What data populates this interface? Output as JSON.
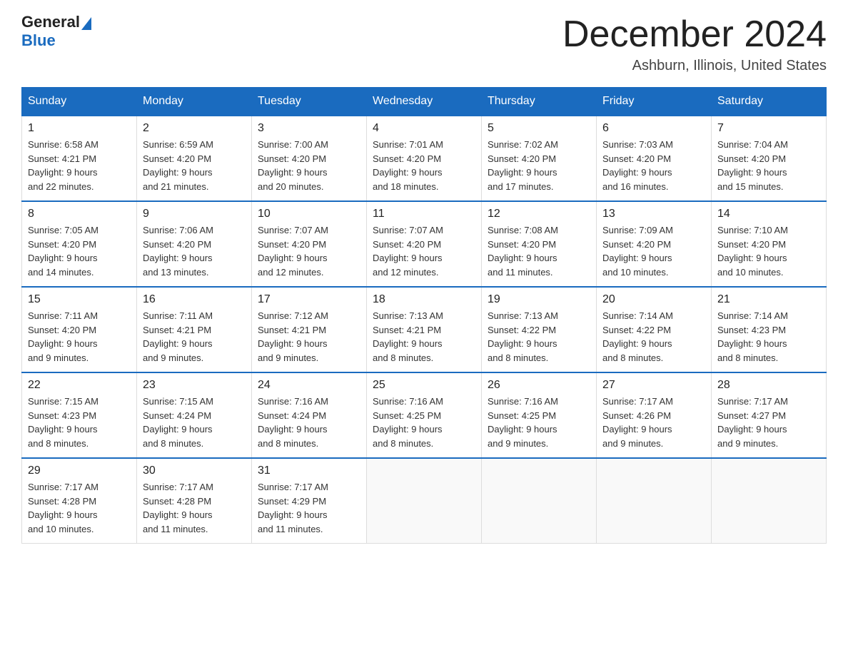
{
  "header": {
    "logo_general": "General",
    "logo_blue": "Blue",
    "month_title": "December 2024",
    "location": "Ashburn, Illinois, United States"
  },
  "weekdays": [
    "Sunday",
    "Monday",
    "Tuesday",
    "Wednesday",
    "Thursday",
    "Friday",
    "Saturday"
  ],
  "weeks": [
    [
      {
        "day": "1",
        "sunrise": "6:58 AM",
        "sunset": "4:21 PM",
        "daylight": "9 hours and 22 minutes."
      },
      {
        "day": "2",
        "sunrise": "6:59 AM",
        "sunset": "4:20 PM",
        "daylight": "9 hours and 21 minutes."
      },
      {
        "day": "3",
        "sunrise": "7:00 AM",
        "sunset": "4:20 PM",
        "daylight": "9 hours and 20 minutes."
      },
      {
        "day": "4",
        "sunrise": "7:01 AM",
        "sunset": "4:20 PM",
        "daylight": "9 hours and 18 minutes."
      },
      {
        "day": "5",
        "sunrise": "7:02 AM",
        "sunset": "4:20 PM",
        "daylight": "9 hours and 17 minutes."
      },
      {
        "day": "6",
        "sunrise": "7:03 AM",
        "sunset": "4:20 PM",
        "daylight": "9 hours and 16 minutes."
      },
      {
        "day": "7",
        "sunrise": "7:04 AM",
        "sunset": "4:20 PM",
        "daylight": "9 hours and 15 minutes."
      }
    ],
    [
      {
        "day": "8",
        "sunrise": "7:05 AM",
        "sunset": "4:20 PM",
        "daylight": "9 hours and 14 minutes."
      },
      {
        "day": "9",
        "sunrise": "7:06 AM",
        "sunset": "4:20 PM",
        "daylight": "9 hours and 13 minutes."
      },
      {
        "day": "10",
        "sunrise": "7:07 AM",
        "sunset": "4:20 PM",
        "daylight": "9 hours and 12 minutes."
      },
      {
        "day": "11",
        "sunrise": "7:07 AM",
        "sunset": "4:20 PM",
        "daylight": "9 hours and 12 minutes."
      },
      {
        "day": "12",
        "sunrise": "7:08 AM",
        "sunset": "4:20 PM",
        "daylight": "9 hours and 11 minutes."
      },
      {
        "day": "13",
        "sunrise": "7:09 AM",
        "sunset": "4:20 PM",
        "daylight": "9 hours and 10 minutes."
      },
      {
        "day": "14",
        "sunrise": "7:10 AM",
        "sunset": "4:20 PM",
        "daylight": "9 hours and 10 minutes."
      }
    ],
    [
      {
        "day": "15",
        "sunrise": "7:11 AM",
        "sunset": "4:20 PM",
        "daylight": "9 hours and 9 minutes."
      },
      {
        "day": "16",
        "sunrise": "7:11 AM",
        "sunset": "4:21 PM",
        "daylight": "9 hours and 9 minutes."
      },
      {
        "day": "17",
        "sunrise": "7:12 AM",
        "sunset": "4:21 PM",
        "daylight": "9 hours and 9 minutes."
      },
      {
        "day": "18",
        "sunrise": "7:13 AM",
        "sunset": "4:21 PM",
        "daylight": "9 hours and 8 minutes."
      },
      {
        "day": "19",
        "sunrise": "7:13 AM",
        "sunset": "4:22 PM",
        "daylight": "9 hours and 8 minutes."
      },
      {
        "day": "20",
        "sunrise": "7:14 AM",
        "sunset": "4:22 PM",
        "daylight": "9 hours and 8 minutes."
      },
      {
        "day": "21",
        "sunrise": "7:14 AM",
        "sunset": "4:23 PM",
        "daylight": "9 hours and 8 minutes."
      }
    ],
    [
      {
        "day": "22",
        "sunrise": "7:15 AM",
        "sunset": "4:23 PM",
        "daylight": "9 hours and 8 minutes."
      },
      {
        "day": "23",
        "sunrise": "7:15 AM",
        "sunset": "4:24 PM",
        "daylight": "9 hours and 8 minutes."
      },
      {
        "day": "24",
        "sunrise": "7:16 AM",
        "sunset": "4:24 PM",
        "daylight": "9 hours and 8 minutes."
      },
      {
        "day": "25",
        "sunrise": "7:16 AM",
        "sunset": "4:25 PM",
        "daylight": "9 hours and 8 minutes."
      },
      {
        "day": "26",
        "sunrise": "7:16 AM",
        "sunset": "4:25 PM",
        "daylight": "9 hours and 9 minutes."
      },
      {
        "day": "27",
        "sunrise": "7:17 AM",
        "sunset": "4:26 PM",
        "daylight": "9 hours and 9 minutes."
      },
      {
        "day": "28",
        "sunrise": "7:17 AM",
        "sunset": "4:27 PM",
        "daylight": "9 hours and 9 minutes."
      }
    ],
    [
      {
        "day": "29",
        "sunrise": "7:17 AM",
        "sunset": "4:28 PM",
        "daylight": "9 hours and 10 minutes."
      },
      {
        "day": "30",
        "sunrise": "7:17 AM",
        "sunset": "4:28 PM",
        "daylight": "9 hours and 11 minutes."
      },
      {
        "day": "31",
        "sunrise": "7:17 AM",
        "sunset": "4:29 PM",
        "daylight": "9 hours and 11 minutes."
      },
      null,
      null,
      null,
      null
    ]
  ]
}
